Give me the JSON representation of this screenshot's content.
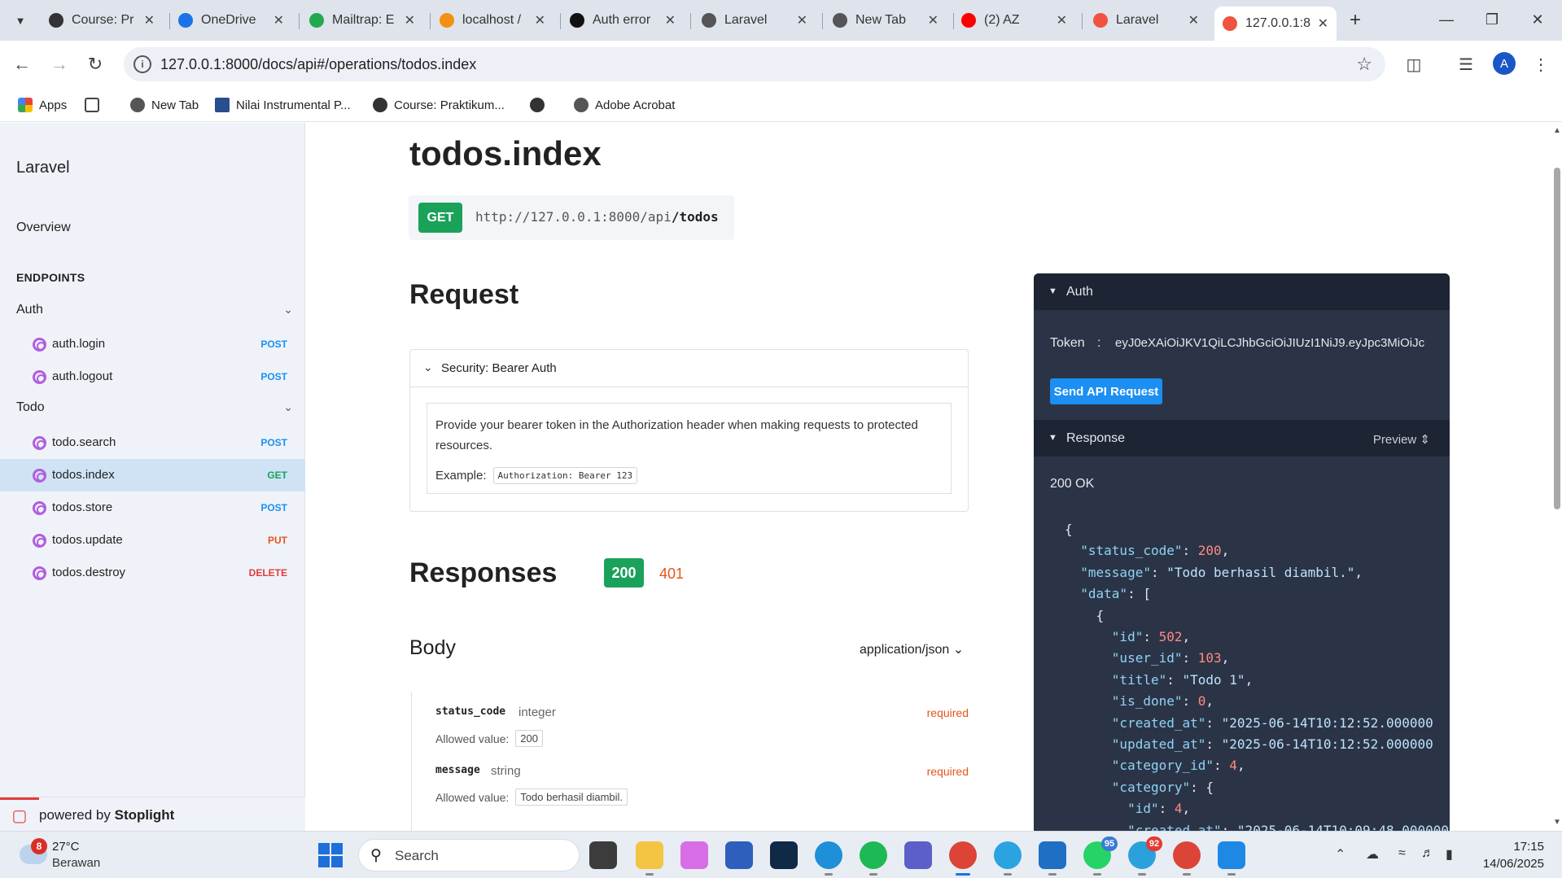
{
  "browser": {
    "tabs": [
      {
        "title": "Course: Pr",
        "fav_color": "#333333"
      },
      {
        "title": "OneDrive",
        "fav_color": "#1a73e8"
      },
      {
        "title": "Mailtrap: E",
        "fav_color": "#22a94f"
      },
      {
        "title": "localhost /",
        "fav_color": "#f29111"
      },
      {
        "title": "Auth error",
        "fav_color": "#111111"
      },
      {
        "title": "Laravel",
        "fav_color": "#555555"
      },
      {
        "title": "New Tab",
        "fav_color": "#555555"
      },
      {
        "title": "(2) AZ",
        "fav_color": "#ff0000"
      },
      {
        "title": "Laravel",
        "fav_color": "#f05340"
      },
      {
        "title": "127.0.0.1:8",
        "fav_color": "#f05340"
      }
    ],
    "url": "127.0.0.1:8000/docs/api#/operations/todos.index",
    "profile_initial": "A",
    "bookmarks": [
      {
        "label": "Apps"
      },
      {
        "label": ""
      },
      {
        "label": "New Tab"
      },
      {
        "label": "Nilai Instrumental P..."
      },
      {
        "label": "Course: Praktikum..."
      },
      {
        "label": ""
      },
      {
        "label": "Adobe Acrobat"
      }
    ]
  },
  "sidebar": {
    "title": "Laravel",
    "overview": "Overview",
    "endpoints_heading": "ENDPOINTS",
    "groups": [
      {
        "name": "Auth"
      },
      {
        "name": "Todo"
      }
    ],
    "items": [
      {
        "label": "auth.login",
        "method": "POST",
        "color": "#1b8ff2"
      },
      {
        "label": "auth.logout",
        "method": "POST",
        "color": "#1b8ff2"
      },
      {
        "label": "todo.search",
        "method": "POST",
        "color": "#1b8ff2"
      },
      {
        "label": "todos.index",
        "method": "GET",
        "color": "#1aa25a"
      },
      {
        "label": "todos.store",
        "method": "POST",
        "color": "#1b8ff2"
      },
      {
        "label": "todos.update",
        "method": "PUT",
        "color": "#e5551a"
      },
      {
        "label": "todos.destroy",
        "method": "DELETE",
        "color": "#e33b3b"
      }
    ],
    "powered_prefix": "powered by",
    "powered_brand": "Stoplight"
  },
  "main": {
    "title": "todos.index",
    "method": "GET",
    "url_base": "http://127.0.0.1:8000/api",
    "url_path": "/todos",
    "request_heading": "Request",
    "security_label": "Security: Bearer Auth",
    "security_desc": "Provide your bearer token in the Authorization header when making requests to protected resources.",
    "example_label": "Example:",
    "example_value": "Authorization: Bearer 123",
    "responses_heading": "Responses",
    "status_codes": [
      "200",
      "401"
    ],
    "body_heading": "Body",
    "content_type": "application/json",
    "fields": [
      {
        "name": "status_code",
        "type": "integer",
        "required": "required",
        "allowed_label": "Allowed value:",
        "allowed": "200"
      },
      {
        "name": "message",
        "type": "string",
        "required": "required",
        "allowed_label": "Allowed value:",
        "allowed": "Todo berhasil diambil."
      }
    ]
  },
  "panel": {
    "auth_label": "Auth",
    "token_label": "Token",
    "token_colon": ":",
    "token_value": "eyJ0eXAiOiJKV1QiLCJhbGciOiJIUzI1NiJ9.eyJpc3MiOiJc",
    "send_button": "Send API Request",
    "response_label": "Response",
    "preview_label": "Preview",
    "status_text": "200 OK",
    "json_lines": [
      [
        {
          "t": "{",
          "c": "pun"
        }
      ],
      [
        {
          "t": "  \"status_code\"",
          "c": "key"
        },
        {
          "t": ": ",
          "c": "pun"
        },
        {
          "t": "200",
          "c": "num"
        },
        {
          "t": ",",
          "c": "pun"
        }
      ],
      [
        {
          "t": "  \"message\"",
          "c": "key"
        },
        {
          "t": ": ",
          "c": "pun"
        },
        {
          "t": "\"Todo berhasil diambil.\"",
          "c": "str"
        },
        {
          "t": ",",
          "c": "pun"
        }
      ],
      [
        {
          "t": "  \"data\"",
          "c": "key"
        },
        {
          "t": ": [",
          "c": "pun"
        }
      ],
      [
        {
          "t": "    {",
          "c": "pun"
        }
      ],
      [
        {
          "t": "      \"id\"",
          "c": "key"
        },
        {
          "t": ": ",
          "c": "pun"
        },
        {
          "t": "502",
          "c": "num"
        },
        {
          "t": ",",
          "c": "pun"
        }
      ],
      [
        {
          "t": "      \"user_id\"",
          "c": "key"
        },
        {
          "t": ": ",
          "c": "pun"
        },
        {
          "t": "103",
          "c": "num"
        },
        {
          "t": ",",
          "c": "pun"
        }
      ],
      [
        {
          "t": "      \"title\"",
          "c": "key"
        },
        {
          "t": ": ",
          "c": "pun"
        },
        {
          "t": "\"Todo 1\"",
          "c": "str"
        },
        {
          "t": ",",
          "c": "pun"
        }
      ],
      [
        {
          "t": "      \"is_done\"",
          "c": "key"
        },
        {
          "t": ": ",
          "c": "pun"
        },
        {
          "t": "0",
          "c": "num"
        },
        {
          "t": ",",
          "c": "pun"
        }
      ],
      [
        {
          "t": "      \"created_at\"",
          "c": "key"
        },
        {
          "t": ": ",
          "c": "pun"
        },
        {
          "t": "\"2025-06-14T10:12:52.000000",
          "c": "str"
        }
      ],
      [
        {
          "t": "      \"updated_at\"",
          "c": "key"
        },
        {
          "t": ": ",
          "c": "pun"
        },
        {
          "t": "\"2025-06-14T10:12:52.000000",
          "c": "str"
        }
      ],
      [
        {
          "t": "      \"category_id\"",
          "c": "key"
        },
        {
          "t": ": ",
          "c": "pun"
        },
        {
          "t": "4",
          "c": "num"
        },
        {
          "t": ",",
          "c": "pun"
        }
      ],
      [
        {
          "t": "      \"category\"",
          "c": "key"
        },
        {
          "t": ": {",
          "c": "pun"
        }
      ],
      [
        {
          "t": "        \"id\"",
          "c": "key"
        },
        {
          "t": ": ",
          "c": "pun"
        },
        {
          "t": "4",
          "c": "num"
        },
        {
          "t": ",",
          "c": "pun"
        }
      ],
      [
        {
          "t": "        \"created_at\"",
          "c": "key"
        },
        {
          "t": ": ",
          "c": "pun"
        },
        {
          "t": "\"2025-06-14T10:09:48.000000",
          "c": "str"
        }
      ]
    ]
  },
  "taskbar": {
    "weather_badge": "8",
    "temperature": "27°C",
    "condition": "Berawan",
    "search_placeholder": "Search",
    "badges": {
      "whatsapp": "95",
      "telegram": "92"
    },
    "time": "17:15",
    "date": "14/06/2025"
  }
}
